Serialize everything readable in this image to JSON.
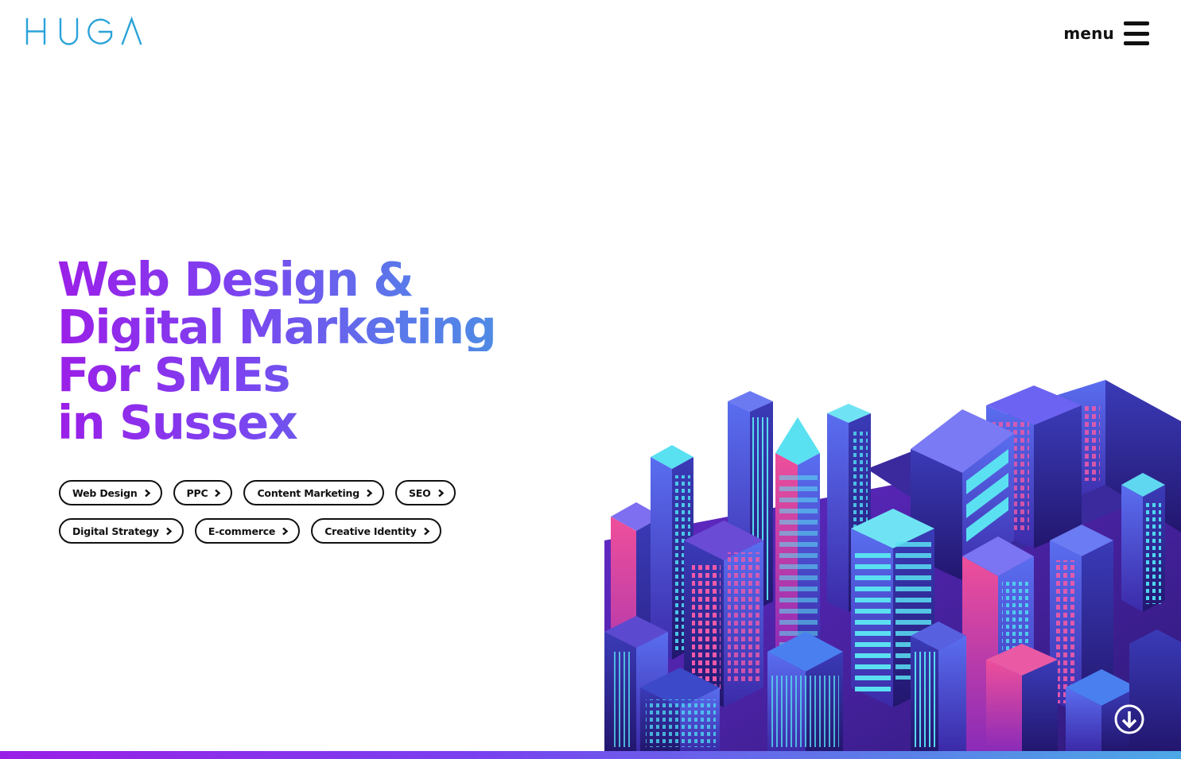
{
  "header": {
    "logo_text": "HUGA",
    "menu_label": "menu",
    "logo_icon": "huga-logo-icon",
    "menu_icon": "hamburger-icon"
  },
  "hero": {
    "headline_lines": [
      "Web Design &",
      "Digital Marketing",
      "For SMEs",
      "in Sussex"
    ],
    "services": [
      [
        {
          "label": "Web Design",
          "icon": "chevron-right-icon"
        },
        {
          "label": "PPC",
          "icon": "chevron-right-icon"
        },
        {
          "label": "Content Marketing",
          "icon": "chevron-right-icon"
        },
        {
          "label": "SEO",
          "icon": "chevron-right-icon"
        }
      ],
      [
        {
          "label": "Digital Strategy",
          "icon": "chevron-right-icon"
        },
        {
          "label": "E-commerce",
          "icon": "chevron-right-icon"
        },
        {
          "label": "Creative Identity",
          "icon": "chevron-right-icon"
        }
      ]
    ],
    "illustration": "isometric-city-illustration",
    "scroll_icon": "arrow-down-circle-icon"
  },
  "colors": {
    "logo": "#2aa3d9",
    "gradient_start": "#9b1fe8",
    "gradient_end": "#4d8fe3",
    "text": "#111111"
  }
}
